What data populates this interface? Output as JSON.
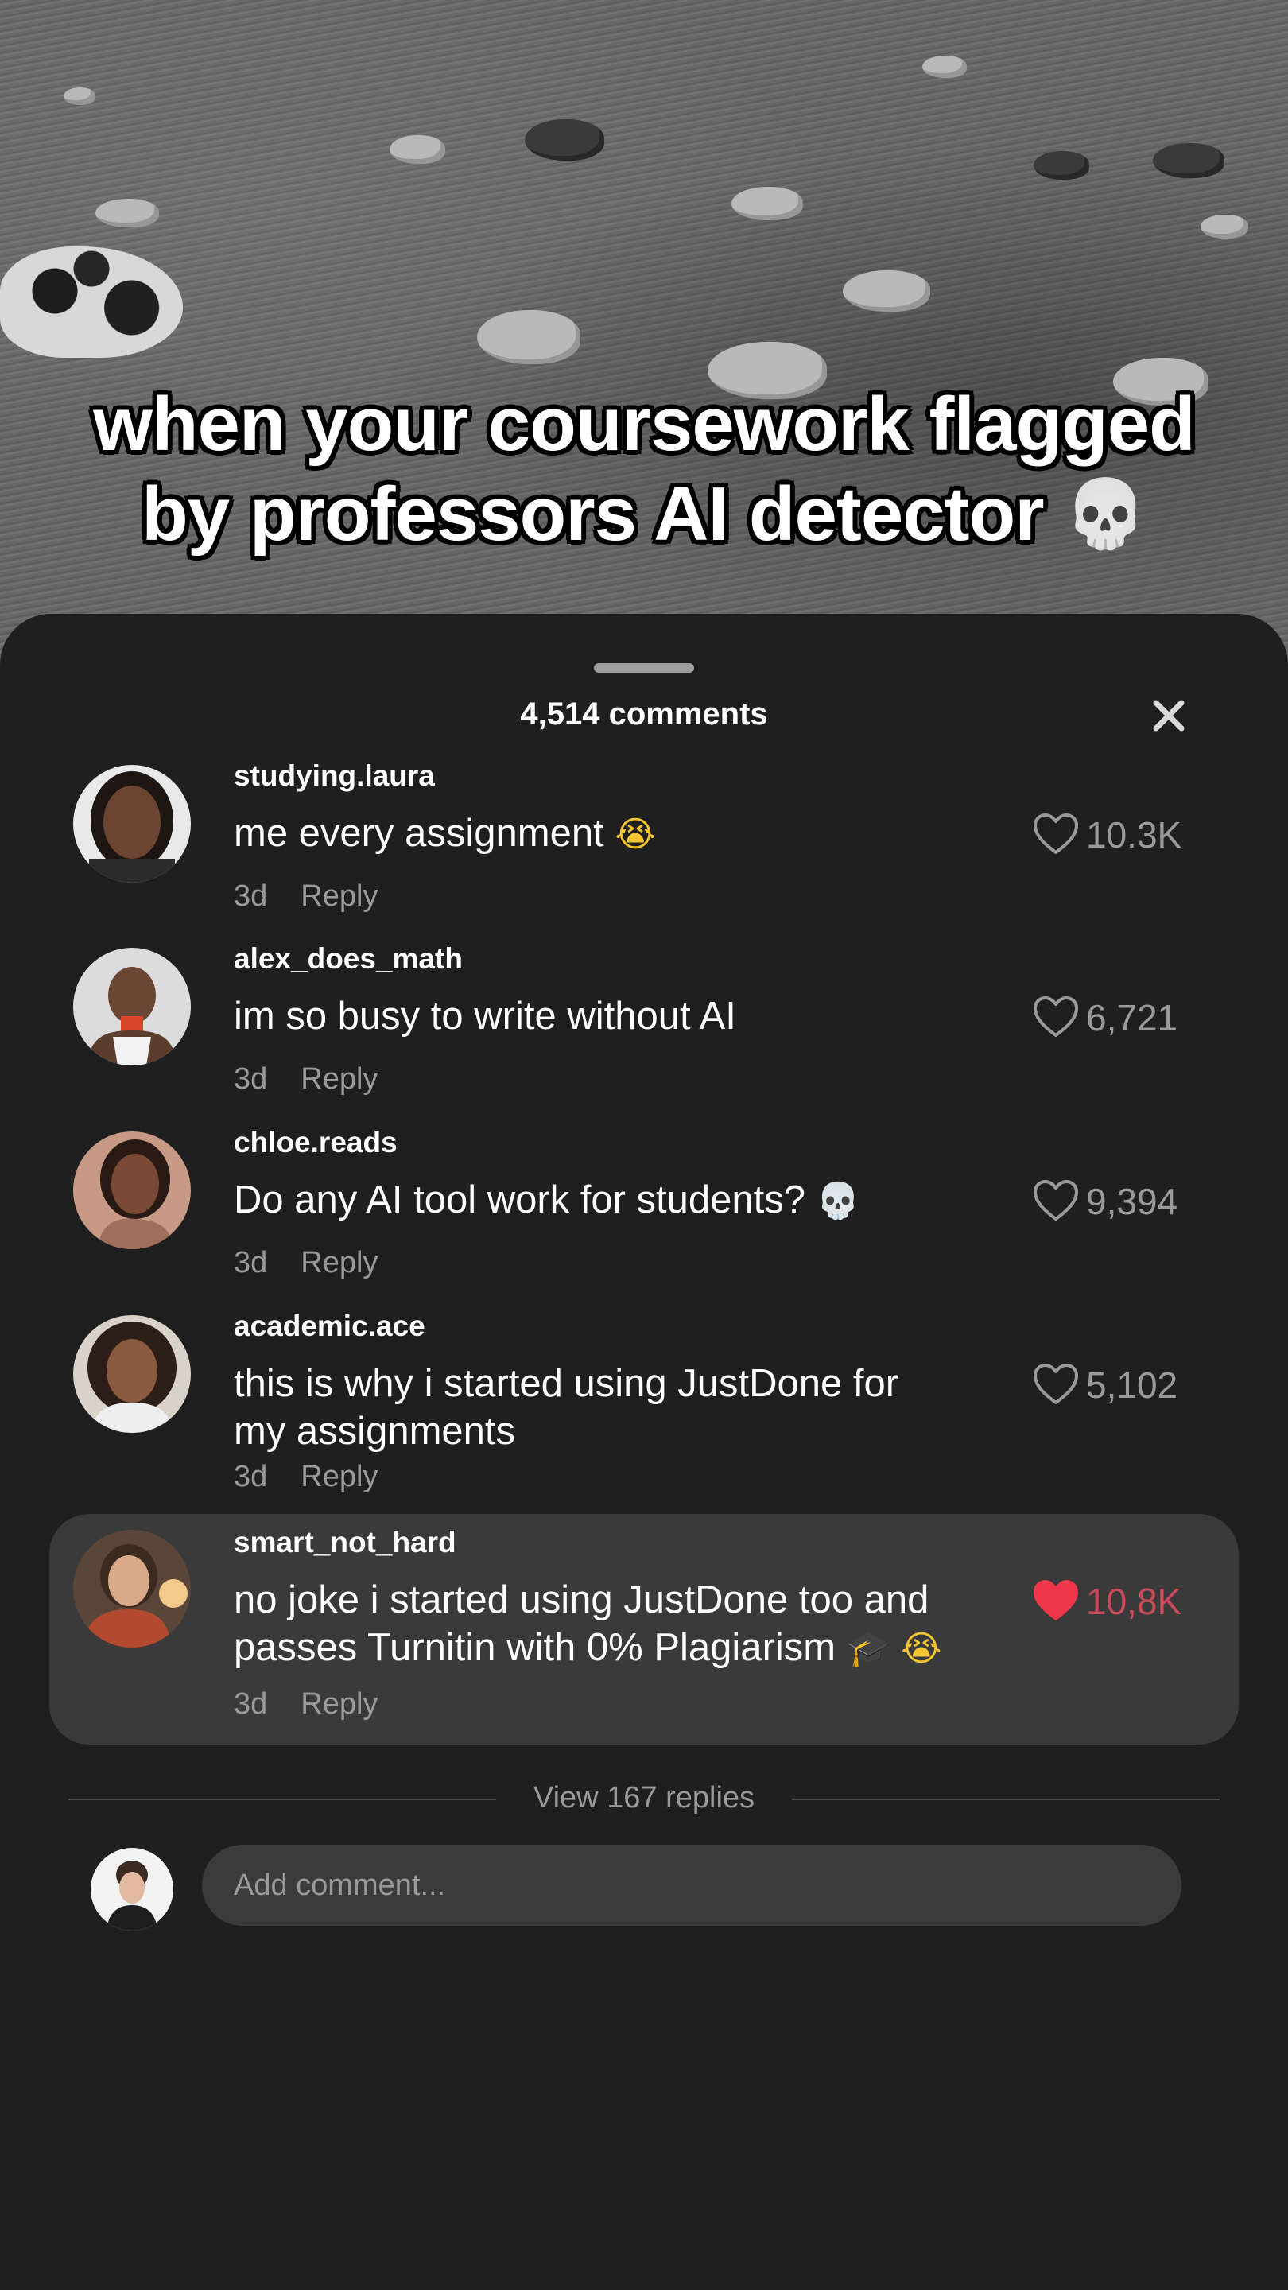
{
  "video": {
    "caption_line1": "when your coursework flagged",
    "caption_line2": "by professors AI detector",
    "caption_emoji": "💀"
  },
  "sheet": {
    "title": "4,514 comments",
    "close_icon": "close-icon"
  },
  "comments": [
    {
      "username": "studying.laura",
      "text": "me every assignment",
      "emoji": "😭",
      "age": "3d",
      "reply_label": "Reply",
      "likes": "10.3K",
      "liked": false
    },
    {
      "username": "alex_does_math",
      "text": "im so busy to write without AI",
      "age": "3d",
      "reply_label": "Reply",
      "likes": "6,721",
      "liked": false
    },
    {
      "username": "chloe.reads",
      "text": "Do any AI tool work for students?",
      "emoji": "💀",
      "age": "3d",
      "reply_label": "Reply",
      "likes": "9,394",
      "liked": false
    },
    {
      "username": "academic.ace",
      "text": "this is why i started using JustDone for my assignments",
      "age": "3d",
      "reply_label": "Reply",
      "likes": "5,102",
      "liked": false
    },
    {
      "username": "smart_not_hard",
      "text_line1": "no joke i started using JustDone too and",
      "text_line2": "passes Turnitin with 0% Plagiarism",
      "emoji_1": "🎓",
      "emoji_2": "😭",
      "age": "3d",
      "reply_label": "Reply",
      "likes": "10,8K",
      "liked": true
    }
  ],
  "view_replies": "View 167 replies",
  "composer": {
    "placeholder": "Add comment..."
  },
  "colors": {
    "sheet_bg": "#1f1f1f",
    "highlight_bg": "#3a3a3a",
    "muted_text": "#9a9a9a",
    "liked_heart": "#f0364b",
    "liked_count": "#c94a5a"
  }
}
